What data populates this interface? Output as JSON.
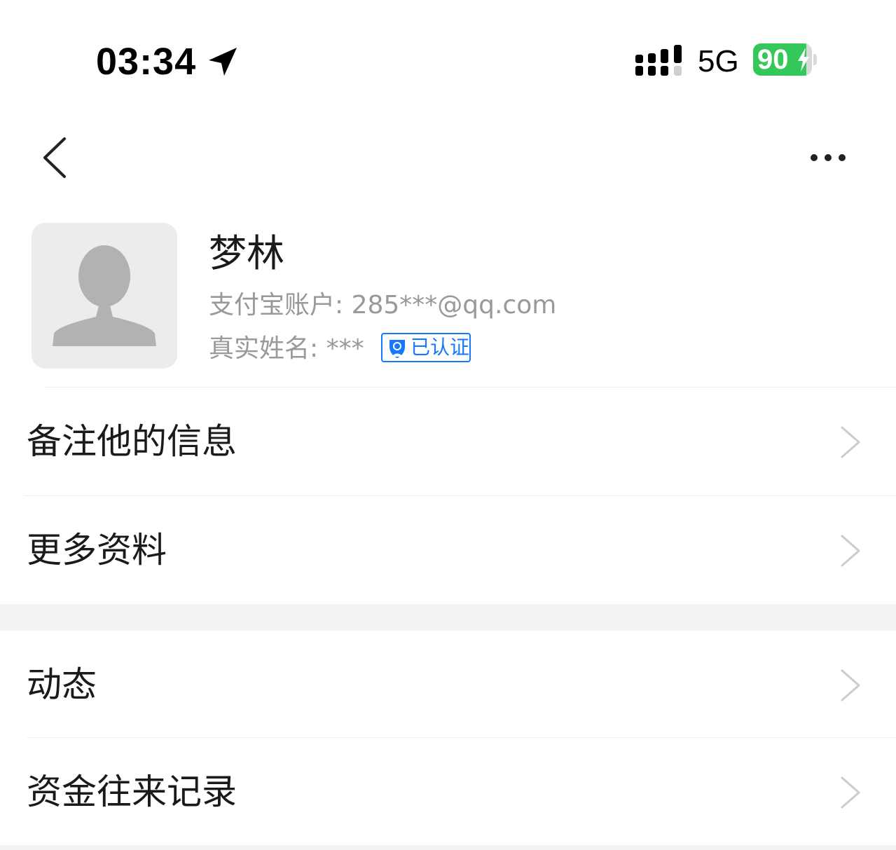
{
  "status_bar": {
    "time": "03:34",
    "network": "5G",
    "battery": "90",
    "battery_level": 0.9,
    "battery_color": "#34c759"
  },
  "nav": {
    "back_icon": "chevron-left-icon",
    "more_icon": "ellipsis-icon"
  },
  "profile": {
    "name": "梦林",
    "account_label": "支付宝账户:",
    "account_value": "285***@qq.com",
    "realname_label": "真实姓名:",
    "realname_value": "***",
    "verified_label": "已认证",
    "accent_color": "#1677ff"
  },
  "menu": {
    "items": [
      {
        "label": "备注他的信息"
      },
      {
        "label": "更多资料"
      },
      {
        "label": "动态"
      },
      {
        "label": "资金往来记录"
      }
    ]
  }
}
